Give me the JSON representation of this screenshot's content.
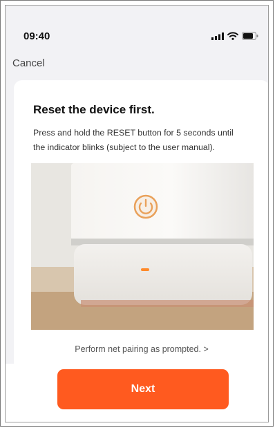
{
  "status_bar": {
    "time": "09:40",
    "icons": [
      "cellular-signal-icon",
      "wifi-icon",
      "battery-icon"
    ]
  },
  "nav": {
    "cancel_label": "Cancel"
  },
  "card": {
    "title": "Reset the device first.",
    "instruction": "Press and hold the RESET button for 5 seconds until the indicator blinks (subject to the user manual).",
    "link_text": "Perform net pairing as prompted. >"
  },
  "footer": {
    "next_label": "Next"
  },
  "colors": {
    "accent": "#ff5a1f",
    "indicator": "#ff8a2a"
  }
}
